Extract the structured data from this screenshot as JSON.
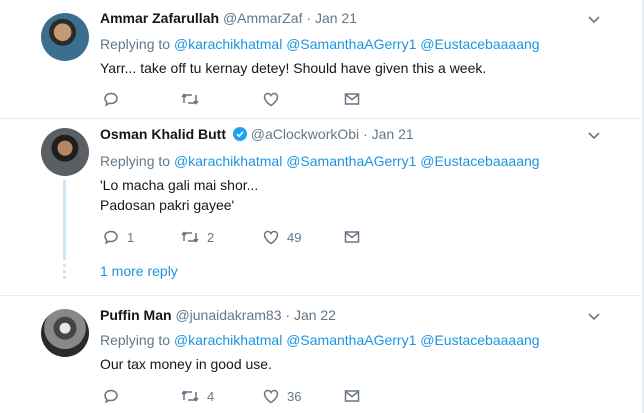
{
  "tweets": [
    {
      "name": "Ammar Zafarullah",
      "handle": "@AmmarZaf",
      "separator": "·",
      "date": "Jan 21",
      "replying_prefix": "Replying to",
      "mentions": [
        "@karachikhatmal",
        "@SamanthaAGerry1",
        "@Eustacebaaaang"
      ],
      "text": "Yarr... take off tu kernay detey! Should have given this a week.",
      "counts": {
        "reply": "",
        "retweet": "",
        "like": ""
      }
    },
    {
      "name": "Osman Khalid Butt",
      "verified": true,
      "handle": "@aClockworkObi",
      "separator": "·",
      "date": "Jan 21",
      "replying_prefix": "Replying to",
      "mentions": [
        "@karachikhatmal",
        "@SamanthaAGerry1",
        "@Eustacebaaaang"
      ],
      "text_lines": [
        "'Lo macha gali mai shor...",
        "Padosan pakri gayee'"
      ],
      "counts": {
        "reply": "1",
        "retweet": "2",
        "like": "49"
      },
      "more_replies": "1 more reply"
    },
    {
      "name": "Puffin Man",
      "handle": "@junaidakram83",
      "separator": "·",
      "date": "Jan 22",
      "replying_prefix": "Replying to",
      "mentions": [
        "@karachikhatmal",
        "@SamanthaAGerry1",
        "@Eustacebaaaang"
      ],
      "text": "Our tax money in good use.",
      "counts": {
        "reply": "",
        "retweet": "4",
        "like": "36"
      }
    }
  ],
  "icons": {
    "reply": "reply-icon",
    "retweet": "retweet-icon",
    "like": "heart-icon",
    "dm": "envelope-icon",
    "caret": "chevron-down-icon",
    "verified": "verified-badge-icon"
  },
  "colors": {
    "link": "#1b95e0",
    "muted": "#657786",
    "thread": "#d0e6f5",
    "verified": "#1da1f2"
  }
}
